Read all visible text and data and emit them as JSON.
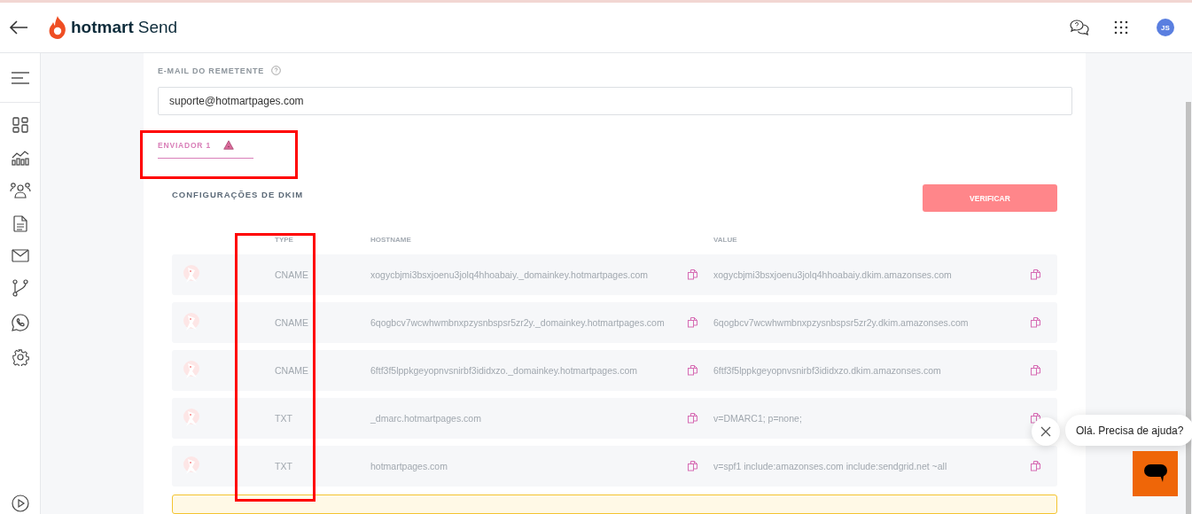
{
  "header": {
    "brand": "hotmart",
    "product": "Send",
    "avatar_initials": "JS"
  },
  "sender": {
    "label": "E-MAIL DO REMETENTE",
    "value": "suporte@hotmartpages.com"
  },
  "tabs": [
    {
      "label": "ENVIADOR 1",
      "selected": true,
      "warning": true
    }
  ],
  "dkim": {
    "title": "CONFIGURAÇÕES DE DKIM",
    "verify_button": "VERIFICAR",
    "columns": [
      "TYPE",
      "HOSTNAME",
      "VALUE"
    ],
    "rows": [
      {
        "type": "CNAME",
        "hostname": "xogycbjmi3bsxjoenu3jolq4hhoabaiy._domainkey.hotmartpages.com",
        "value": "xogycbjmi3bsxjoenu3jolq4hhoabaiy.dkim.amazonses.com"
      },
      {
        "type": "CNAME",
        "hostname": "6qogbcv7wcwhwmbnxpzysnbspsr5zr2y._domainkey.hotmartpages.com",
        "value": "6qogbcv7wcwhwmbnxpzysnbspsr5zr2y.dkim.amazonses.com"
      },
      {
        "type": "CNAME",
        "hostname": "6ftf3f5lppkgeyopnvsnirbf3ididxzo._domainkey.hotmartpages.com",
        "value": "6ftf3f5lppkgeyopnvsnirbf3ididxzo.dkim.amazonses.com"
      },
      {
        "type": "TXT",
        "hostname": "_dmarc.hotmartpages.com",
        "value": "v=DMARC1; p=none;"
      },
      {
        "type": "TXT",
        "hostname": "hotmartpages.com",
        "value": "v=spf1 include:amazonses.com include:sendgrid.net ~all"
      }
    ]
  },
  "chat": {
    "greeting": "Olá. Precisa de ajuda?"
  }
}
